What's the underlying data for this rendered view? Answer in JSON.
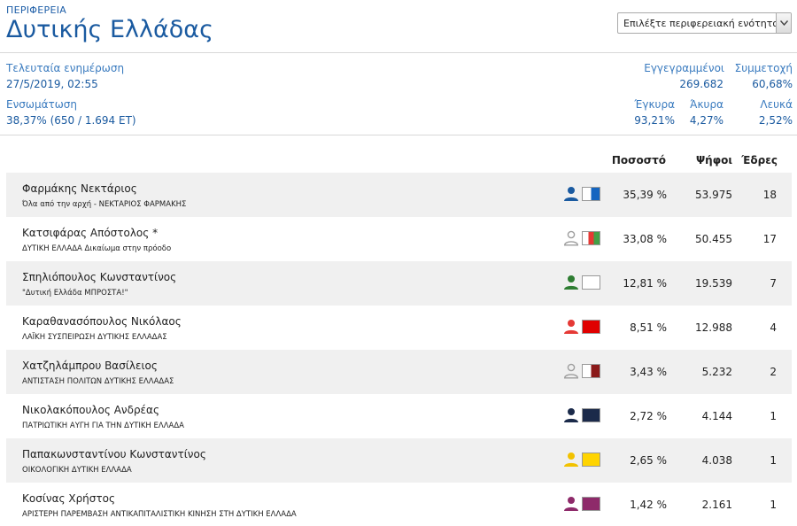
{
  "header": {
    "region_label": "ΠΕΡΙΦΕΡΕΙΑ",
    "region_name": "Δυτικής Ελλάδας",
    "select_value": "Επιλέξτε περιφερειακή ενότητα..."
  },
  "stats": {
    "last_update_label": "Τελευταία ενημέρωση",
    "last_update_value": "27/5/2019, 02:55",
    "integration_label": "Ενσωμάτωση",
    "integration_value": "38,37% (650 / 1.694 ΕΤ)",
    "registered_label": "Εγγεγραμμένοι",
    "registered_value": "269.682",
    "turnout_label": "Συμμετοχή",
    "turnout_value": "60,68%",
    "valid_label": "Έγκυρα",
    "valid_value": "93,21%",
    "invalid_label": "Άκυρα",
    "invalid_value": "4,27%",
    "blank_label": "Λευκά",
    "blank_value": "2,52%"
  },
  "table": {
    "col_percent": "Ποσοστό",
    "col_votes": "Ψήφοι",
    "col_seats": "Έδρες",
    "rows": [
      {
        "candidate": "Φαρμάκης Νεκτάριος",
        "party": "Όλα από την αρχή - ΝΕΚΤΑΡΙΟΣ ΦΑΡΜΑΚΗΣ",
        "percent": "35,39 %",
        "votes": "53.975",
        "seats": "18",
        "person_color": "#1a5aa0",
        "swatch": [
          "#ffffff",
          "#1565c0"
        ]
      },
      {
        "candidate": "Κατσιφάρας Απόστολος *",
        "party": "ΔΥΤΙΚΗ ΕΛΛΑΔΑ Δικαίωμα στην πρόοδο",
        "percent": "33,08 %",
        "votes": "50.455",
        "seats": "17",
        "person_color": "#9e9e9e",
        "swatch": [
          "#ffffff",
          "#e53935",
          "#43a047"
        ]
      },
      {
        "candidate": "Σπηλιόπουλος Κωνσταντίνος",
        "party": "\"Δυτική Ελλάδα ΜΠΡΟΣΤΑ!\"",
        "percent": "12,81 %",
        "votes": "19.539",
        "seats": "7",
        "person_color": "#2e7d32",
        "swatch": [
          "#ffffff"
        ]
      },
      {
        "candidate": "Καραθανασόπουλος Νικόλαος",
        "party": "ΛΑΪΚΗ ΣΥΣΠΕΙΡΩΣΗ ΔΥΤΙΚΗΣ ΕΛΛΑΔΑΣ",
        "percent": "8,51 %",
        "votes": "12.988",
        "seats": "4",
        "person_color": "#e53935",
        "swatch": [
          "#e00000"
        ]
      },
      {
        "candidate": "Χατζηλάμπρου Βασίλειος",
        "party": "ΑΝΤΙΣΤΑΣΗ ΠΟΛΙΤΩΝ ΔΥΤΙΚΗΣ ΕΛΛΑΔΑΣ",
        "percent": "3,43 %",
        "votes": "5.232",
        "seats": "2",
        "person_color": "#9e9e9e",
        "swatch": [
          "#ffffff",
          "#8b1a1a"
        ]
      },
      {
        "candidate": "Νικολακόπουλος Ανδρέας",
        "party": "ΠΑΤΡΙΩΤΙΚΗ ΑΥΓΗ ΓΙΑ ΤΗΝ ΔΥΤΙΚΗ ΕΛΛΑΔΑ",
        "percent": "2,72 %",
        "votes": "4.144",
        "seats": "1",
        "person_color": "#1b2a4a",
        "swatch": [
          "#1b2a4a"
        ]
      },
      {
        "candidate": "Παπακωνσταντίνου Κωνσταντίνος",
        "party": "ΟΙΚΟΛΟΓΙΚΗ ΔΥΤΙΚΗ ΕΛΛΑΔΑ",
        "percent": "2,65 %",
        "votes": "4.038",
        "seats": "1",
        "person_color": "#f2c200",
        "swatch": [
          "#ffd400"
        ]
      },
      {
        "candidate": "Κοσίνας Χρήστος",
        "party": "ΑΡΙΣΤΕΡΗ ΠΑΡΕΜΒΑΣΗ ΑΝΤΙΚΑΠΙΤΑΛΙΣΤΙΚΗ ΚΙΝΗΣΗ ΣΤΗ ΔΥΤΙΚΗ ΕΛΛΑΔΑ",
        "percent": "1,42 %",
        "votes": "2.161",
        "seats": "1",
        "person_color": "#8e2a6a",
        "swatch": [
          "#8e2a6a"
        ]
      }
    ]
  }
}
